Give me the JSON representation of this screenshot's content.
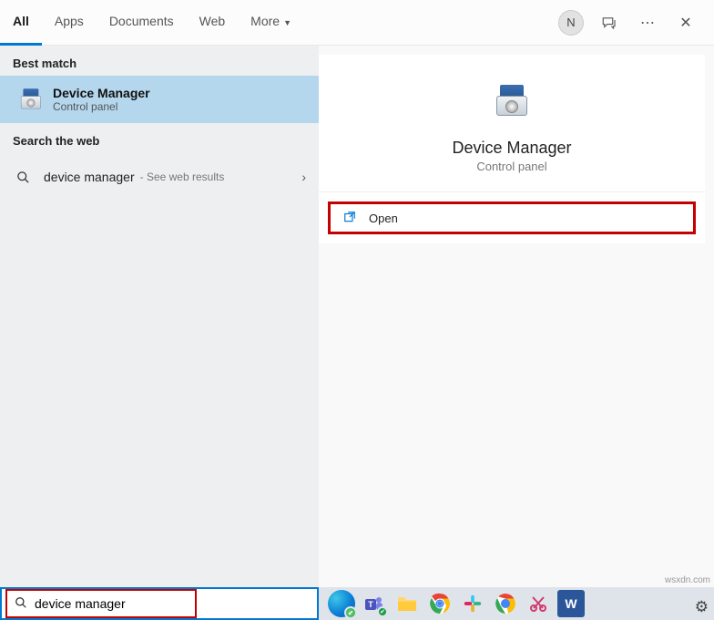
{
  "tabs": {
    "all": "All",
    "apps": "Apps",
    "documents": "Documents",
    "web": "Web",
    "more": "More"
  },
  "header": {
    "avatar_initial": "N"
  },
  "sections": {
    "best_match": "Best match",
    "search_web": "Search the web"
  },
  "best_match": {
    "title": "Device Manager",
    "subtitle": "Control panel"
  },
  "web_result": {
    "query": "device manager",
    "hint": "- See web results"
  },
  "preview": {
    "title": "Device Manager",
    "subtitle": "Control panel"
  },
  "actions": {
    "open": "Open"
  },
  "search": {
    "value": "device manager"
  },
  "watermark": "wsxdn.com"
}
